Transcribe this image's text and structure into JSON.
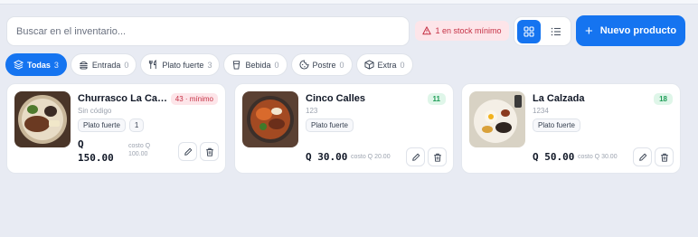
{
  "toolbar": {
    "search_placeholder": "Buscar en el inventario...",
    "stock_alert": "1 en stock mínimo",
    "new_product_label": "Nuevo producto",
    "view_mode": "grid"
  },
  "categories": [
    {
      "label": "Todas",
      "count": "3",
      "icon": "layers-icon",
      "active": true
    },
    {
      "label": "Entrada",
      "count": "0",
      "icon": "burger-icon",
      "active": false
    },
    {
      "label": "Plato fuerte",
      "count": "3",
      "icon": "utensils-icon",
      "active": false
    },
    {
      "label": "Bebida",
      "count": "0",
      "icon": "cup-icon",
      "active": false
    },
    {
      "label": "Postre",
      "count": "0",
      "icon": "cookie-icon",
      "active": false
    },
    {
      "label": "Extra",
      "count": "0",
      "icon": "box-icon",
      "active": false
    }
  ],
  "products": [
    {
      "name": "Churrasco La Casa",
      "code": "Sin código",
      "stock_badge": "43 · mínimo",
      "stock_status": "low",
      "category": "Plato fuerte",
      "extra_tag": "1",
      "price_currency": "Q",
      "price_amount": "150.00",
      "cost_label": "costo Q",
      "cost_amount": "100.00"
    },
    {
      "name": "Cinco Calles",
      "code": "123",
      "stock_badge": "11",
      "stock_status": "ok",
      "category": "Plato fuerte",
      "price": "Q 30.00",
      "cost": "costo Q 20.00"
    },
    {
      "name": "La Calzada",
      "code": "1234",
      "stock_badge": "18",
      "stock_status": "ok",
      "category": "Plato fuerte",
      "price": "Q 50.00",
      "cost": "costo Q 30.00"
    }
  ],
  "colors": {
    "accent": "#1574f0",
    "danger": "#c53145",
    "success": "#1f9d57",
    "background": "#e8ebf3"
  }
}
